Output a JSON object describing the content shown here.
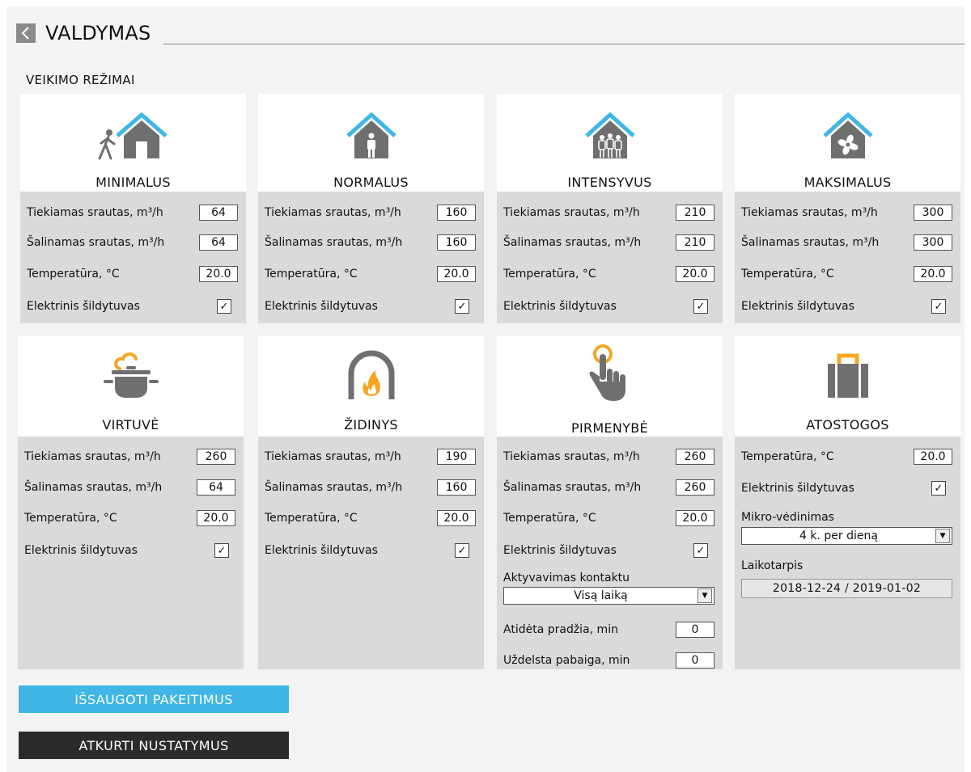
{
  "header": {
    "title": "VALDYMAS",
    "back_icon": "chevron-left-icon"
  },
  "section_label": "VEIKIMO REŽIMAI",
  "cards": {
    "minimalus": {
      "title": "MINIMALUS",
      "icon": "walking-person-house-icon",
      "supply_label": "Tiekiamas srautas, m³/h",
      "supply_value": "64",
      "extract_label": "Šalinamas srautas, m³/h",
      "extract_value": "64",
      "temp_label": "Temperatūra, °C",
      "temp_value": "20.0",
      "heater_label": "Elektrinis šildytuvas",
      "heater_checked": true
    },
    "normalus": {
      "title": "NORMALUS",
      "icon": "person-house-icon",
      "supply_label": "Tiekiamas srautas, m³/h",
      "supply_value": "160",
      "extract_label": "Šalinamas srautas, m³/h",
      "extract_value": "160",
      "temp_label": "Temperatūra, °C",
      "temp_value": "20.0",
      "heater_label": "Elektrinis šildytuvas",
      "heater_checked": true
    },
    "intensyvus": {
      "title": "INTENSYVUS",
      "icon": "group-house-icon",
      "supply_label": "Tiekiamas srautas, m³/h",
      "supply_value": "210",
      "extract_label": "Šalinamas srautas, m³/h",
      "extract_value": "210",
      "temp_label": "Temperatūra, °C",
      "temp_value": "20.0",
      "heater_label": "Elektrinis šildytuvas",
      "heater_checked": true
    },
    "maksimalus": {
      "title": "MAKSIMALUS",
      "icon": "fan-house-icon",
      "supply_label": "Tiekiamas srautas, m³/h",
      "supply_value": "300",
      "extract_label": "Šalinamas srautas, m³/h",
      "extract_value": "300",
      "temp_label": "Temperatūra, °C",
      "temp_value": "20.0",
      "heater_label": "Elektrinis šildytuvas",
      "heater_checked": true
    },
    "virtuve": {
      "title": "VIRTUVĖ",
      "icon": "cooking-pot-icon",
      "supply_label": "Tiekiamas srautas, m³/h",
      "supply_value": "260",
      "extract_label": "Šalinamas srautas, m³/h",
      "extract_value": "64",
      "temp_label": "Temperatūra, °C",
      "temp_value": "20.0",
      "heater_label": "Elektrinis šildytuvas",
      "heater_checked": true
    },
    "zidinys": {
      "title": "ŽIDINYS",
      "icon": "fireplace-icon",
      "supply_label": "Tiekiamas srautas, m³/h",
      "supply_value": "190",
      "extract_label": "Šalinamas srautas, m³/h",
      "extract_value": "160",
      "temp_label": "Temperatūra, °C",
      "temp_value": "20.0",
      "heater_label": "Elektrinis šildytuvas",
      "heater_checked": true
    },
    "pirmenybe": {
      "title": "PIRMENYBĖ",
      "icon": "touch-hand-icon",
      "supply_label": "Tiekiamas srautas, m³/h",
      "supply_value": "260",
      "extract_label": "Šalinamas srautas, m³/h",
      "extract_value": "260",
      "temp_label": "Temperatūra, °C",
      "temp_value": "20.0",
      "heater_label": "Elektrinis šildytuvas",
      "heater_checked": true,
      "contact_label": "Aktyvavimas kontaktu",
      "contact_value": "Visą laiką",
      "delay_start_label": "Atidėta pradžia, min",
      "delay_start_value": "0",
      "delay_end_label": "Uždelsta pabaiga, min",
      "delay_end_value": "0"
    },
    "atostogos": {
      "title": "ATOSTOGOS",
      "icon": "suitcase-icon",
      "temp_label": "Temperatūra, °C",
      "temp_value": "20.0",
      "heater_label": "Elektrinis šildytuvas",
      "heater_checked": true,
      "micro_label": "Mikro-vėdinimas",
      "micro_value": "4 k. per dieną",
      "period_label": "Laikotarpis",
      "period_value": "2018-12-24 / 2019-01-02"
    }
  },
  "buttons": {
    "save": "IŠSAUGOTI PAKEITIMUS",
    "reset": "ATKURTI NUSTATYMUS"
  },
  "colors": {
    "accent_blue": "#3fb6e6",
    "icon_gray": "#6f6f6f",
    "accent_orange": "#f5a623",
    "dark": "#2b2b2b",
    "panel_gray": "#dadada"
  },
  "check_glyph": "✓"
}
